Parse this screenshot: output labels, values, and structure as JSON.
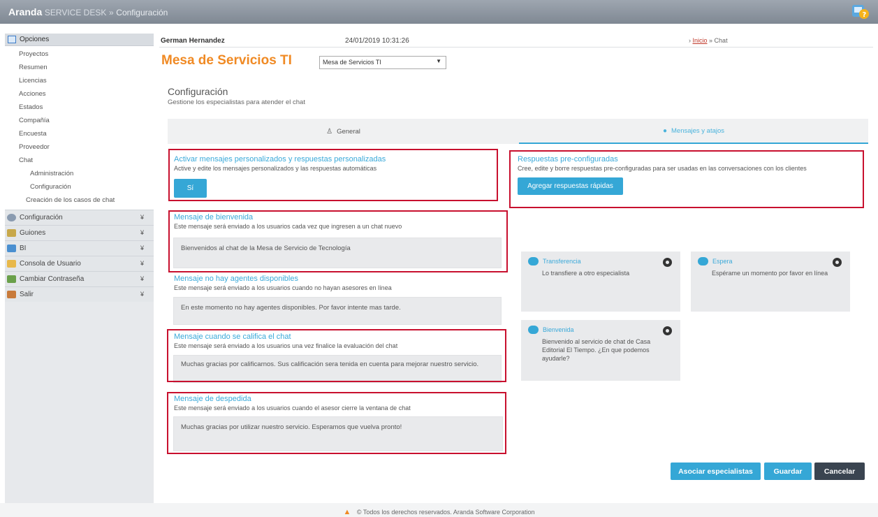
{
  "app": {
    "brand": "Aranda",
    "product": "SERVICE DESK",
    "separator": "»",
    "section": "Configuración"
  },
  "sidebar": {
    "opciones_label": "Opciones",
    "items": [
      {
        "label": "Proyectos"
      },
      {
        "label": "Resumen"
      },
      {
        "label": "Licencias"
      },
      {
        "label": "Acciones"
      },
      {
        "label": "Estados"
      },
      {
        "label": "Compañía"
      },
      {
        "label": "Encuesta"
      },
      {
        "label": "Proveedor"
      },
      {
        "label": "Chat"
      },
      {
        "label": "Administración"
      },
      {
        "label": "Configuración"
      },
      {
        "label": "Creación de los casos de chat"
      }
    ],
    "menus": [
      {
        "label": "Configuración",
        "icon": "gear-icon",
        "color": "#8a9bb0"
      },
      {
        "label": "Guiones",
        "icon": "script-icon",
        "color": "#c8a84a"
      },
      {
        "label": "BI",
        "icon": "chart-icon",
        "color": "#4a8fd0"
      },
      {
        "label": "Consola de Usuario",
        "icon": "console-icon",
        "color": "#e8b84a"
      },
      {
        "label": "Cambiar Contraseña",
        "icon": "key-icon",
        "color": "#6aa04a"
      },
      {
        "label": "Salir",
        "icon": "exit-icon",
        "color": "#c87a3a"
      }
    ],
    "chevron": "¥"
  },
  "header": {
    "user": "German Hernandez",
    "datetime": "24/01/2019 10:31:26",
    "breadcrumb_sep": "›",
    "breadcrumb_home": "Inicio",
    "breadcrumb_current": "» Chat"
  },
  "page": {
    "title": "Mesa de Servicios TI",
    "project_select": "Mesa de Servicios TI",
    "config_title": "Configuración",
    "config_desc": "Gestione los especialistas para atender el chat"
  },
  "tabs": {
    "general": "General",
    "messages": "Mensajes y atajos"
  },
  "left": {
    "activate": {
      "title": "Activar mensajes personalizados y respuestas personalizadas",
      "desc": "Active y edite los mensajes personalizados y las respuestas automáticas",
      "button": "Sí"
    },
    "welcome": {
      "title": "Mensaje de bienvenida",
      "desc": "Este mensaje será enviado a los usuarios cada vez que ingresen a un chat nuevo",
      "value": "Bienvenidos al chat de la Mesa de Servicio de Tecnología"
    },
    "no_agents": {
      "title": "Mensaje no hay agentes disponibles",
      "desc": "Este mensaje será enviado a los usuarios cuando no hayan asesores en línea",
      "value": "En este momento no hay agentes disponibles. Por favor intente mas tarde."
    },
    "rating": {
      "title": "Mensaje cuando se califica el chat",
      "desc": "Este mensaje será enviado a los usuarios una vez finalice la evaluación del chat",
      "value": "Muchas gracias por calificarnos. Sus calificación sera tenida en cuenta para mejorar nuestro servicio."
    },
    "farewell": {
      "title": "Mensaje de despedida",
      "desc": "Este mensaje será enviado a los usuarios cuando el asesor cierre la ventana de chat",
      "value": "Muchas gracias por utilizar nuestro servicio. Esperamos que vuelva pronto!"
    }
  },
  "right": {
    "preconfig": {
      "title": "Respuestas pre-configuradas",
      "desc": "Cree, edite y borre respuestas pre-configuradas para ser usadas en las conversaciones con los clientes",
      "button": "Agregar respuestas rápidas"
    },
    "cards": [
      {
        "title": "Transferencia",
        "text": "Lo transfiere a otro especialista"
      },
      {
        "title": "Espera",
        "text": "Espérame un momento por favor en línea"
      },
      {
        "title": "Bienvenida",
        "text": "Bienvenido al servicio de chat de Casa Editorial El Tiempo. ¿En que podemos ayudarle?"
      }
    ]
  },
  "actions": {
    "assign": "Asociar especialistas",
    "save": "Guardar",
    "cancel": "Cancelar"
  },
  "footer": {
    "text": "© Todos los derechos reservados. Aranda Software Corporation"
  },
  "colors": {
    "accent": "#35a7d6",
    "title": "#f08a24",
    "highlight": "#c8102e",
    "cancel": "#3a4450"
  }
}
